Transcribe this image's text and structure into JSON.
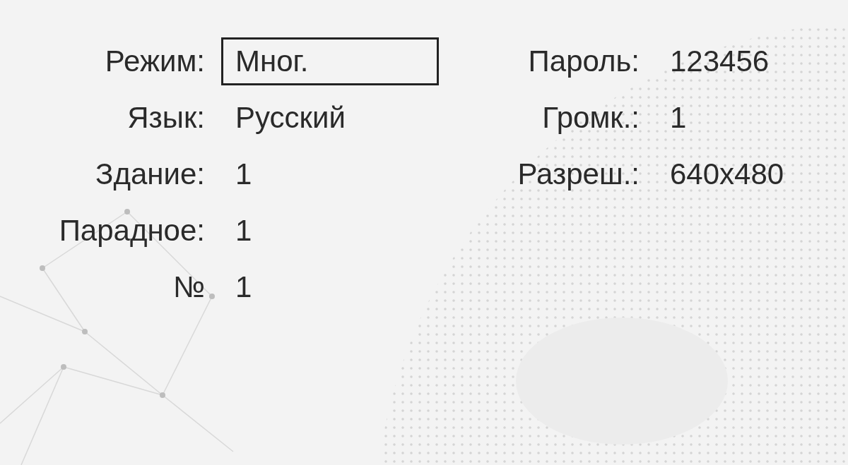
{
  "left_fields": [
    {
      "label": "Режим:",
      "value": "Мног.",
      "selected": true
    },
    {
      "label": "Язык:",
      "value": "Русский",
      "selected": false
    },
    {
      "label": "Здание:",
      "value": "1",
      "selected": false
    },
    {
      "label": "Парадное:",
      "value": "1",
      "selected": false
    },
    {
      "label": "№",
      "value": "1",
      "selected": false
    }
  ],
  "right_fields": [
    {
      "label": "Пароль:",
      "value": "123456",
      "selected": false
    },
    {
      "label": "Громк.:",
      "value": "1",
      "selected": false
    },
    {
      "label": "Разреш.:",
      "value": "640x480",
      "selected": false
    }
  ]
}
